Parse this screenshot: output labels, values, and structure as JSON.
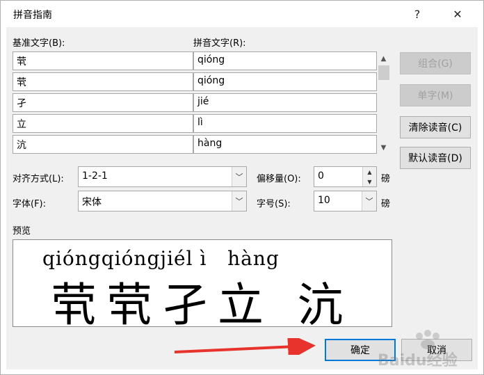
{
  "dialog": {
    "title": "拼音指南",
    "help_glyph": "?",
    "close_glyph": "✕"
  },
  "labels": {
    "base_text": "基准文字(B):",
    "pinyin_text": "拼音文字(R):",
    "alignment": "对齐方式(L):",
    "offset": "偏移量(O):",
    "font": "字体(F):",
    "size": "字号(S):",
    "offset_unit": "磅",
    "size_unit": "磅",
    "preview": "预览"
  },
  "rows": [
    {
      "base": "茕",
      "pinyin": "qióng"
    },
    {
      "base": "茕",
      "pinyin": "qióng"
    },
    {
      "base": "孑",
      "pinyin": "jié"
    },
    {
      "base": "立",
      "pinyin": "lì"
    },
    {
      "base": "沆",
      "pinyin": "hàng"
    }
  ],
  "buttons": {
    "combine": "组合(G)",
    "single": "单字(M)",
    "clear": "清除读音(C)",
    "default": "默认读音(D)",
    "ok": "确定",
    "cancel": "取消"
  },
  "fields": {
    "alignment_value": "1-2-1",
    "offset_value": "0",
    "font_value": "宋体",
    "size_value": "10"
  },
  "preview": {
    "pinyin_line": "qióngqióngjiél ì   hàng",
    "hanzi_line": "茕茕孑立 沆"
  },
  "watermark": {
    "text": "Baidu经验"
  },
  "colors": {
    "ok_border": "#0078d7",
    "arrow": "#e8332c"
  }
}
